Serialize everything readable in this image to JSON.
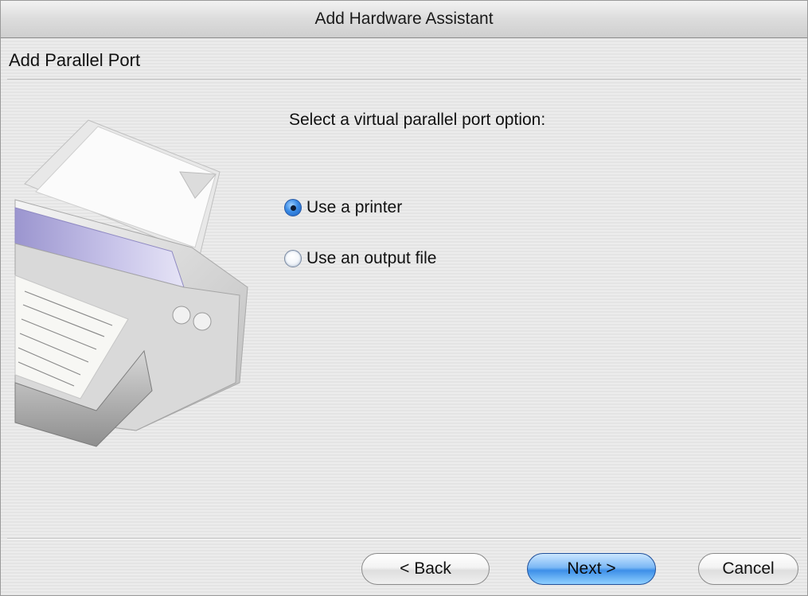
{
  "window": {
    "title": "Add Hardware Assistant"
  },
  "header": {
    "title": "Add Parallel Port"
  },
  "illustration": {
    "icon": "printer-illustration"
  },
  "main": {
    "prompt": "Select a virtual parallel port option:",
    "options": [
      {
        "label": "Use a printer",
        "selected": true
      },
      {
        "label": "Use an output file",
        "selected": false
      }
    ]
  },
  "footer": {
    "back_label": "< Back",
    "next_label": "Next >",
    "cancel_label": "Cancel"
  },
  "colors": {
    "default_button": "#5aa6ef",
    "radio_selected": "#3a8be6"
  }
}
